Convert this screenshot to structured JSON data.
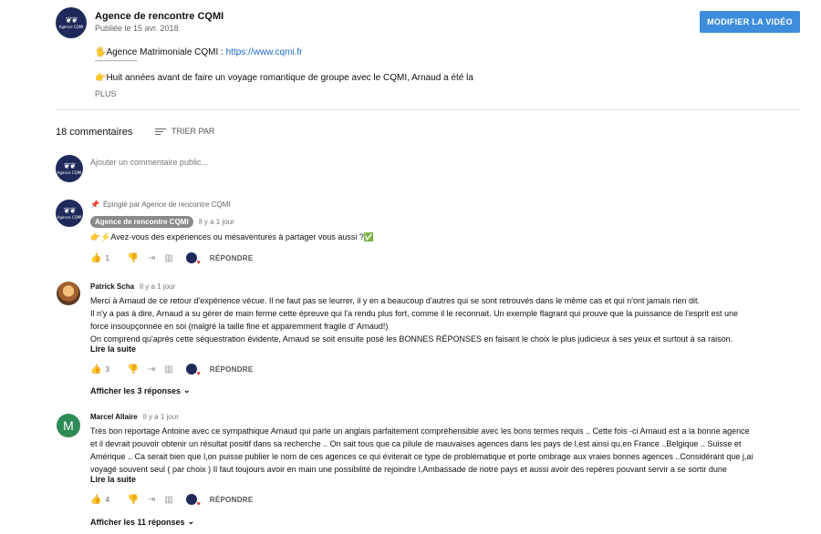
{
  "video": {
    "channel_name": "Agence de rencontre CQMI",
    "published": "Publiée le 15 avr. 2018",
    "edit_button": "MODIFIER LA VIDÉO",
    "desc_line1_prefix": "🖐Agence Matrimoniale CQMI : ",
    "desc_link": "https://www.cqmi.fr",
    "desc_line2": "--------------------",
    "desc_line3": "👉Huit années avant de faire un voyage romantique de groupe avec le CQMI, Arnaud a été la",
    "more": "PLUS"
  },
  "comments_header": {
    "count": "18 commentaires",
    "sort": "TRIER PAR"
  },
  "add_comment": {
    "placeholder": "Ajouter un commentaire public..."
  },
  "comments": [
    {
      "pinned": "Épinglé par Agence de rencontre CQMI",
      "author": "Agence de rencontre CQMI",
      "time": "Il y a 1 jour",
      "text": "👉⚡Avez-vous des expériences ou mésaventures à partager vous aussi ?✅",
      "likes": "1",
      "reply": "RÉPONDRE"
    },
    {
      "author": "Patrick Scha",
      "time": "Il y a 1 jour",
      "lines": [
        "Merci à Arnaud de ce retour d'expérience vécue. Il ne faut  pas se leurrer, il y en a beaucoup d'autres qui se sont retrouvés dans le même cas et qui n'ont jamais rien dit.",
        "Il n'y a pas à dire, Arnaud a su gérer de main ferme cette épreuve qui l'a rendu plus fort, comme il le reconnait. Un exemple flagrant  qui prouve que la puissance de l'esprit est une",
        "force insoupçonnée en soi (malgré la taille fine et apparemment fragile d' Arnaud!)",
        " On comprend qu'après cette séquestration évidente, Arnaud se soit ensuite posé les BONNES RÉPONSES  en faisant le choix le plus judicieux à ses yeux et surtout à sa raison."
      ],
      "read_more": "Lire la suite",
      "likes": "3",
      "reply": "RÉPONDRE",
      "show_replies": "Afficher les 3 réponses"
    },
    {
      "author": "Marcel Allaire",
      "avatar_letter": "M",
      "time": "Il y a 1 jour",
      "lines": [
        "Très bon reportage Antoine avec ce sympathique Arnaud qui parle un anglais parfaitement compréhensible avec les bons termes requis .. Cette fois -ci Arnaud est a la bonne agence",
        "et il devrait pouvoir obtenir un résultat positif dans sa recherche .. On sait tous que ca pilule de mauvaises agences dans les pays de l,est ainsi qu,en France ..Belgique .. Suisse et",
        "Amérique .. Ca serait bien que l,on puisse publier le nom de ces agences ce qui éviterait ce type de problématique et porte ombrage aux vraies bonnes agences ..Considérant que j,ai",
        "voyagé souvent seul ( par choix ) Il faut toujours avoir en main une possibilité de rejoindre l,Ambassade de notre pays et aussi avoir des repères pouvant servir a se sortir dune"
      ],
      "read_more": "Lire la suite",
      "likes": "4",
      "reply": "RÉPONDRE",
      "show_replies": "Afficher les 11 réponses"
    }
  ],
  "logo_text": "Agence CQMI"
}
